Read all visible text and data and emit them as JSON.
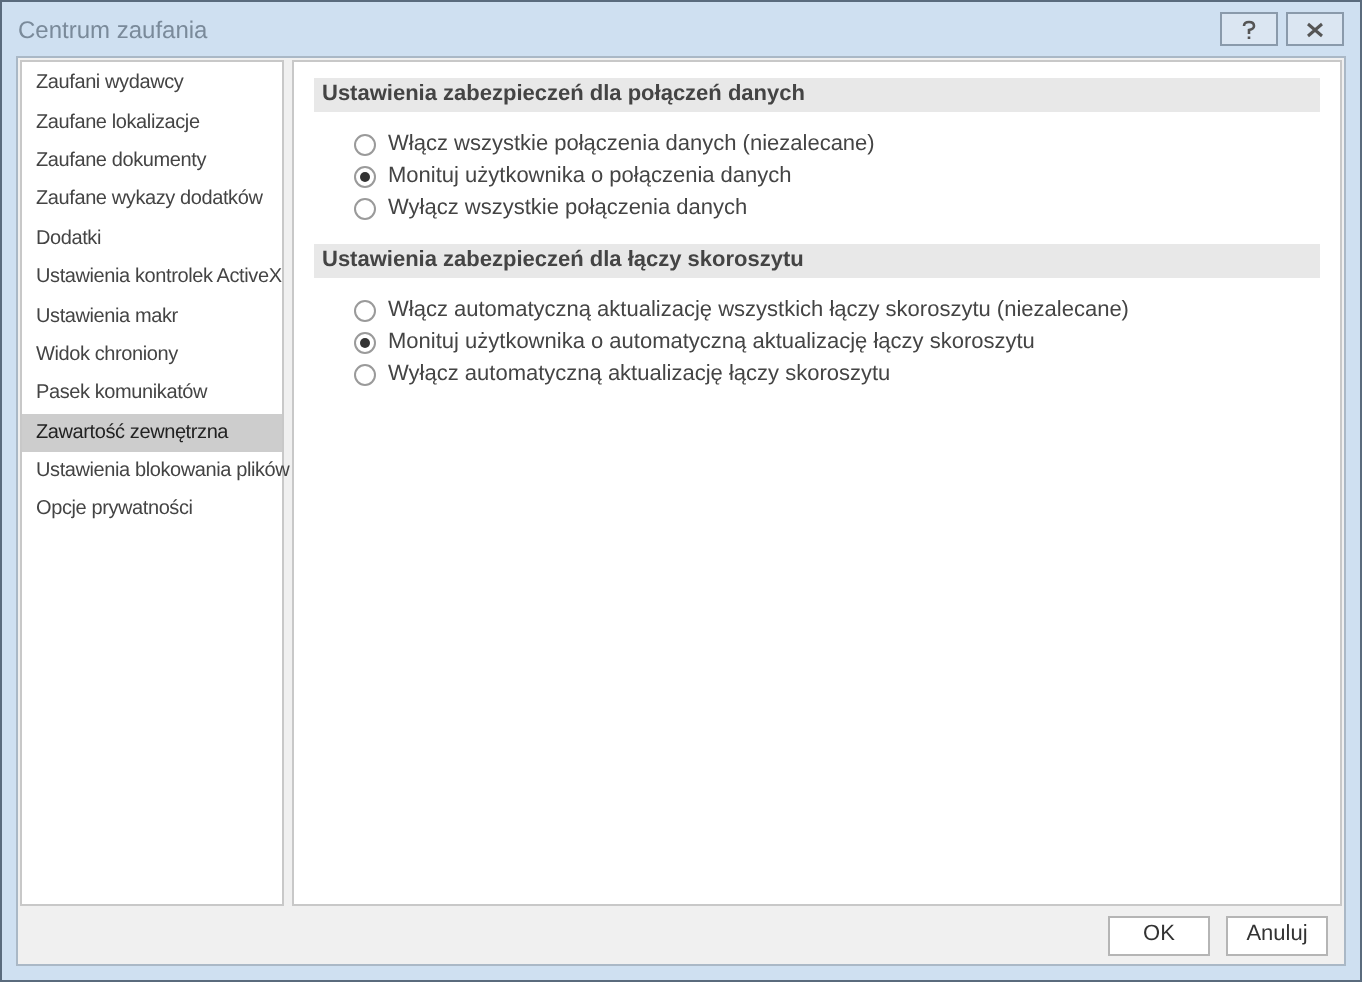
{
  "window": {
    "title": "Centrum zaufania"
  },
  "sidebar": {
    "items": [
      {
        "label": "Zaufani wydawcy",
        "selected": false
      },
      {
        "label": "Zaufane lokalizacje",
        "selected": false
      },
      {
        "label": "Zaufane dokumenty",
        "selected": false
      },
      {
        "label": "Zaufane wykazy dodatków",
        "selected": false
      },
      {
        "label": "Dodatki",
        "selected": false
      },
      {
        "label": "Ustawienia kontrolek ActiveX",
        "selected": false
      },
      {
        "label": "Ustawienia makr",
        "selected": false
      },
      {
        "label": "Widok chroniony",
        "selected": false
      },
      {
        "label": "Pasek komunikatów",
        "selected": false
      },
      {
        "label": "Zawartość zewnętrzna",
        "selected": true
      },
      {
        "label": "Ustawienia blokowania plików",
        "selected": false
      },
      {
        "label": "Opcje prywatności",
        "selected": false
      }
    ]
  },
  "sections": [
    {
      "heading": "Ustawienia zabezpieczeń dla połączeń danych",
      "options": [
        {
          "label": "Włącz wszystkie połączenia danych (niezalecane)",
          "selected": false
        },
        {
          "label": "Monituj użytkownika o połączenia danych",
          "selected": true
        },
        {
          "label": "Wyłącz wszystkie połączenia danych",
          "selected": false
        }
      ]
    },
    {
      "heading": "Ustawienia zabezpieczeń dla łączy skoroszytu",
      "options": [
        {
          "label": "Włącz automatyczną aktualizację wszystkich łączy skoroszytu (niezalecane)",
          "selected": false
        },
        {
          "label": "Monituj użytkownika o automatyczną aktualizację łączy skoroszytu",
          "selected": true
        },
        {
          "label": "Wyłącz automatyczną aktualizację łączy skoroszytu",
          "selected": false
        }
      ]
    }
  ],
  "buttons": [
    "OK",
    "Anuluj"
  ]
}
